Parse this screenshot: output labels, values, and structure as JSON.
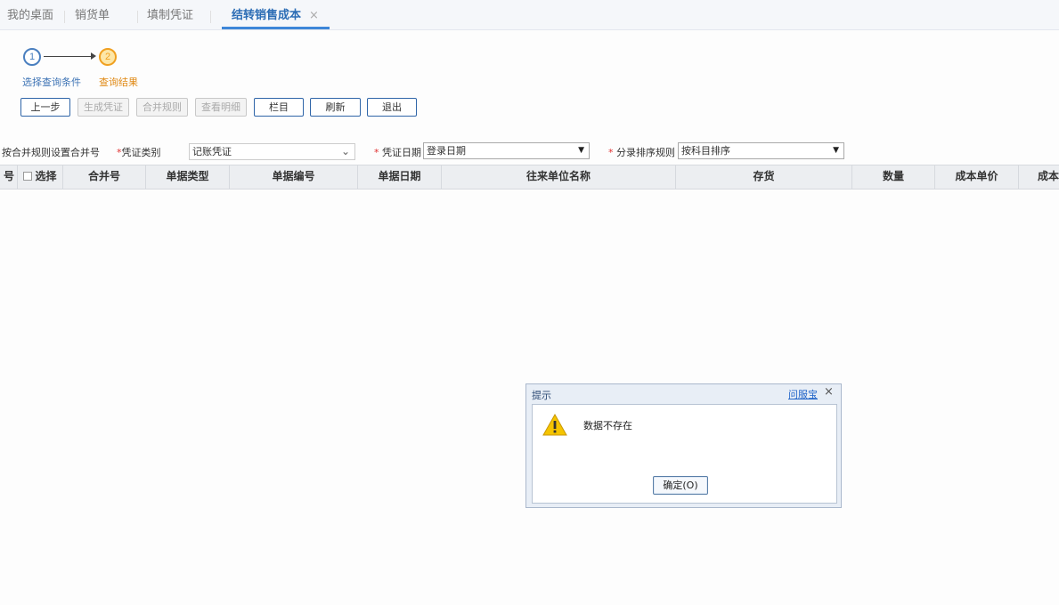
{
  "tabs": [
    {
      "label": "我的桌面"
    },
    {
      "label": "销货单"
    },
    {
      "label": "填制凭证"
    },
    {
      "label": "结转销售成本",
      "close": "×"
    }
  ],
  "steps": {
    "step1_num": "1",
    "step2_num": "2",
    "step1_label": "选择查询条件",
    "step2_label": "查询结果"
  },
  "toolbar": {
    "prev": "上一步",
    "generate": "生成凭证",
    "merge_rule": "合并规则",
    "view_detail": "查看明细",
    "columns": "栏目",
    "refresh": "刷新",
    "exit": "退出"
  },
  "filters": {
    "merge_label": "按合并规则设置合并号",
    "req_mark": "*",
    "voucher_type_label": "凭证类别",
    "voucher_type_value": "记账凭证",
    "voucher_date_label": "凭证日期",
    "voucher_date_value": "登录日期",
    "sort_rule_label": "分录排序规则",
    "sort_rule_value": "按科目排序"
  },
  "grid": {
    "columns": {
      "seq": "号",
      "select": "选择",
      "merge_no": "合并号",
      "doc_type": "单据类型",
      "doc_no": "单据编号",
      "doc_date": "单据日期",
      "partner": "往来单位名称",
      "inventory": "存货",
      "qty": "数量",
      "unit_cost": "成本单价",
      "cost": "成本"
    }
  },
  "dialog": {
    "title": "提示",
    "help_link": "问服宝",
    "close": "×",
    "message": "数据不存在",
    "ok": "确定(O)"
  },
  "colors": {
    "accent": "#2c6db5",
    "step_active": "#f0a020",
    "warning": "#f5c400"
  }
}
